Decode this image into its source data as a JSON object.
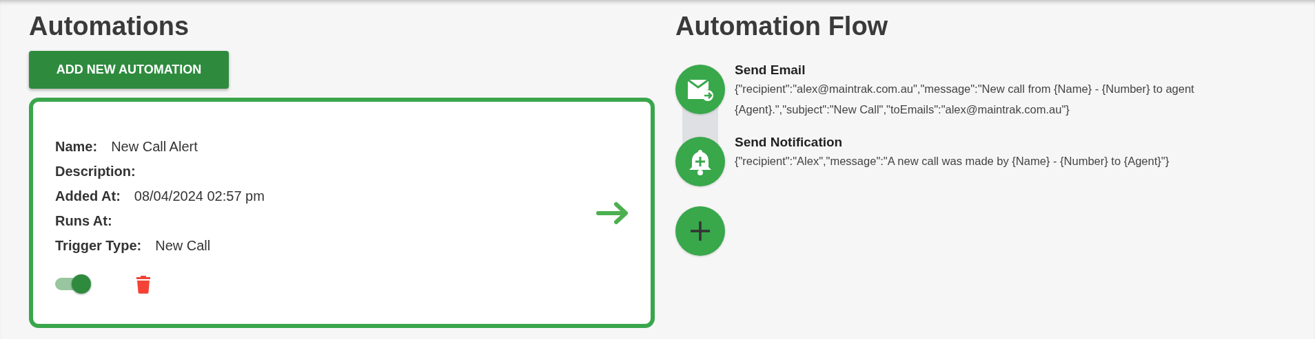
{
  "automations": {
    "title": "Automations",
    "add_button": "ADD NEW AUTOMATION",
    "cards": [
      {
        "fields": [
          {
            "label": "Name:",
            "value": "New Call Alert"
          },
          {
            "label": "Description:"
          },
          {
            "label": "Added At:",
            "value": "08/04/2024 02:57 pm"
          },
          {
            "label": "Runs At:"
          },
          {
            "label": "Trigger Type:",
            "value": "New Call"
          }
        ],
        "enabled": true
      }
    ]
  },
  "flow": {
    "title": "Automation Flow",
    "steps": [
      {
        "kind": "email",
        "title": "Send Email",
        "detail": "{\"recipient\":\"alex@maintrak.com.au\",\"message\":\"New call from {Name} - {Number} to agent {Agent}.\",\"subject\":\"New Call\",\"toEmails\":\"alex@maintrak.com.au\"}"
      },
      {
        "kind": "notification",
        "title": "Send Notification",
        "detail": "{\"recipient\":\"Alex\",\"message\":\"A new call was made by {Name} - {Number} to {Agent}\"}"
      }
    ]
  }
}
